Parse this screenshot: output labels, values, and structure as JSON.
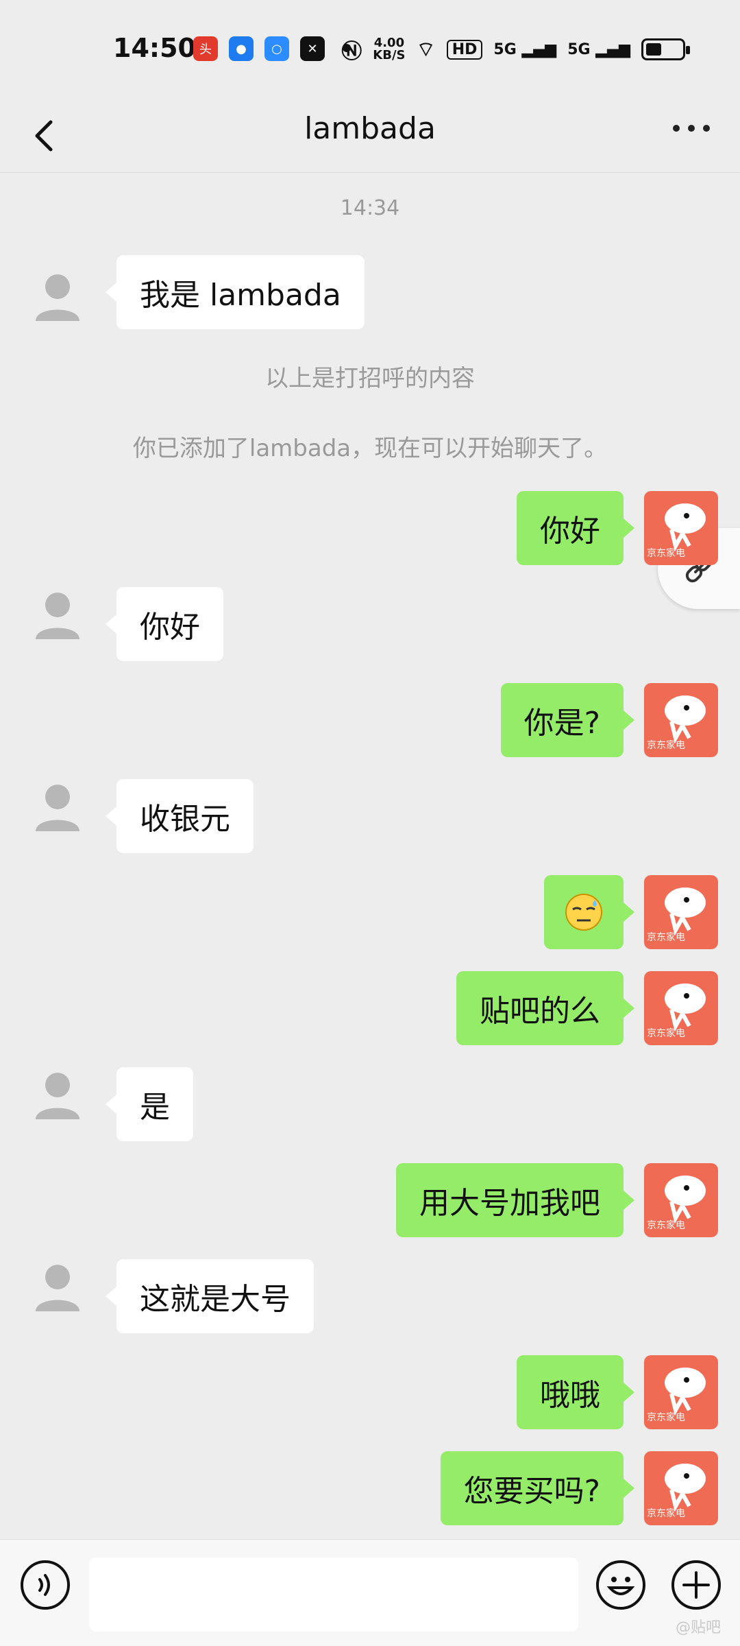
{
  "status": {
    "time": "14:50",
    "network_speed": "4.00\nKB/S",
    "hd_label": "HD",
    "signal1": "5G",
    "signal2": "5G"
  },
  "header": {
    "title": "lambada"
  },
  "chat": {
    "timestamp": "14:34",
    "system_greeting": "以上是打招呼的内容",
    "system_added": "你已添加了lambada，现在可以开始聊天了。",
    "messages": [
      {
        "side": "left",
        "text": "我是 lambada"
      },
      {
        "side": "right",
        "text": "你好"
      },
      {
        "side": "left",
        "text": "你好"
      },
      {
        "side": "right",
        "text": "你是?"
      },
      {
        "side": "left",
        "text": "收银元"
      },
      {
        "side": "right",
        "text": "emoji"
      },
      {
        "side": "right",
        "text": "贴吧的么"
      },
      {
        "side": "left",
        "text": "是"
      },
      {
        "side": "right",
        "text": "用大号加我吧"
      },
      {
        "side": "left",
        "text": "这就是大号"
      },
      {
        "side": "right",
        "text": "哦哦"
      },
      {
        "side": "right",
        "text": "您要买吗?"
      }
    ],
    "avatar_brand_text": "京东家电"
  },
  "input_bar": {
    "placeholder": "",
    "watermark": "@贴吧"
  },
  "colors": {
    "bg": "#ededed",
    "bubble_right": "#95ec69",
    "bubble_left": "#ffffff",
    "jd_avatar": "#ef6b53"
  }
}
